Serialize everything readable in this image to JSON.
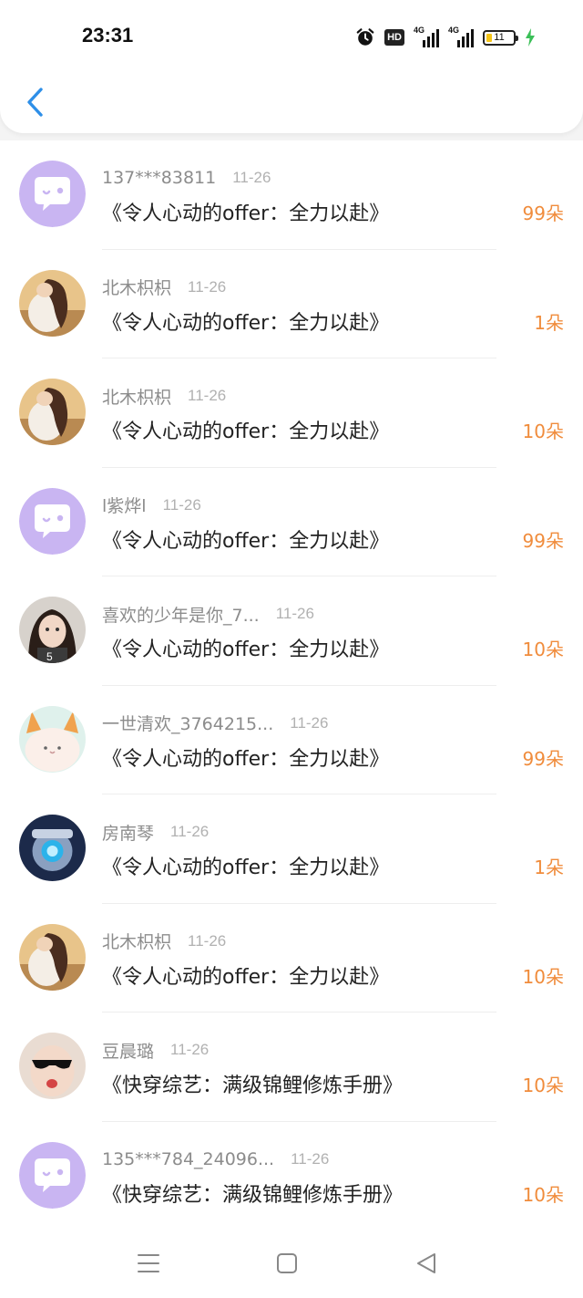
{
  "status_bar": {
    "time": "23:31",
    "hd_label": "HD",
    "signal_1_label": "4G",
    "signal_2_label": "4G",
    "battery_level": "11",
    "icons": [
      "alarm-icon",
      "hd-icon",
      "signal-icon",
      "signal-icon",
      "battery-icon",
      "charging-icon"
    ]
  },
  "header": {
    "back_icon": "chevron-left-icon",
    "accent_color": "#2e8fe8"
  },
  "records": [
    {
      "name": "137***83811",
      "date": "11-26",
      "title": "《令人心动的offer：全力以赴》",
      "count": "99朵",
      "avatar": "default-chat-avatar"
    },
    {
      "name": "北木枳枳",
      "date": "11-26",
      "title": "《令人心动的offer：全力以赴》",
      "count": "1朵",
      "avatar": "photo-avatar-girl-hair"
    },
    {
      "name": "北木枳枳",
      "date": "11-26",
      "title": "《令人心动的offer：全力以赴》",
      "count": "10朵",
      "avatar": "photo-avatar-girl-hair"
    },
    {
      "name": "l紫烨l",
      "date": "11-26",
      "title": "《令人心动的offer：全力以赴》",
      "count": "99朵",
      "avatar": "default-chat-avatar"
    },
    {
      "name": "喜欢的少年是你_7...",
      "date": "11-26",
      "title": "《令人心动的offer：全力以赴》",
      "count": "10朵",
      "avatar": "photo-avatar-girl-face"
    },
    {
      "name": "一世清欢_3764215...",
      "date": "11-26",
      "title": "《令人心动的offer：全力以赴》",
      "count": "99朵",
      "avatar": "cartoon-avatar-bunny"
    },
    {
      "name": "房南琴",
      "date": "11-26",
      "title": "《令人心动的offer：全力以赴》",
      "count": "1朵",
      "avatar": "robot-avatar"
    },
    {
      "name": "北木枳枳",
      "date": "11-26",
      "title": "《令人心动的offer：全力以赴》",
      "count": "10朵",
      "avatar": "photo-avatar-girl-hair"
    },
    {
      "name": "豆晨璐",
      "date": "11-26",
      "title": "《快穿综艺：满级锦鲤修炼手册》",
      "count": "10朵",
      "avatar": "photo-avatar-sunglasses"
    },
    {
      "name": "135***784_24096...",
      "date": "11-26",
      "title": "《快穿综艺：满级锦鲤修炼手册》",
      "count": "10朵",
      "avatar": "default-chat-avatar"
    }
  ],
  "colors": {
    "count": "#f08c3c",
    "name": "#8c8c8c",
    "default_avatar": "#c9b5f2"
  },
  "nav_bar": {
    "icons": [
      "menu-icon",
      "home-square-icon",
      "back-triangle-icon"
    ]
  }
}
